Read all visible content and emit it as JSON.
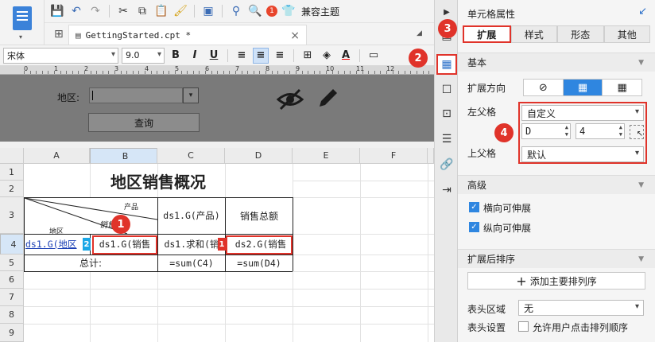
{
  "toolbar": {
    "badge_count": "1",
    "theme_label": "兼容主题"
  },
  "tabbar": {
    "file_tab": "GettingStarted.cpt *",
    "close": "×"
  },
  "format": {
    "font": "宋体",
    "size": "9.0"
  },
  "param_pane": {
    "area_label": "地区:",
    "query_button": "查询",
    "ruler_labels": [
      "0",
      "1",
      "2",
      "3",
      "4",
      "5",
      "6",
      "7",
      "8",
      "9",
      "10",
      "11",
      "12"
    ]
  },
  "sheet": {
    "columns": [
      "A",
      "B",
      "C",
      "D",
      "E",
      "F"
    ],
    "rows": [
      "1",
      "2",
      "3",
      "4",
      "5",
      "6",
      "7",
      "8",
      "9"
    ],
    "title": "地区销售概况",
    "header_product": "产品",
    "header_sales": "销售",
    "header_region": "地区",
    "c3": "ds1.G(产品)",
    "d3": "销售总额",
    "a4": "ds1.G(地区",
    "b4": "ds1.G(销售",
    "c4": "ds1.求和(销",
    "d4": "ds2.G(销售",
    "a5": "总计:",
    "c5": "=sum(C4)",
    "d5": "=sum(D4)",
    "badge_1": "1",
    "badge_2": "2",
    "mini_badge_a": "2",
    "mini_badge_d": "1"
  },
  "right_panel": {
    "title": "单元格属性",
    "badge_3": "3",
    "badge_2": "2",
    "badge_4": "4",
    "tabs": [
      "扩展",
      "样式",
      "形态",
      "其他"
    ],
    "basic_section": "基本",
    "expand_direction": "扩展方向",
    "left_parent": "左父格",
    "left_parent_value": "自定义",
    "left_col": "D",
    "left_row": "4",
    "up_parent": "上父格",
    "up_parent_value": "默认",
    "advanced_section": "高级",
    "h_expand": "横向可伸展",
    "v_expand": "纵向可伸展",
    "sort_section": "扩展后排序",
    "add_sort": "添加主要排列序",
    "header_area": "表头区域",
    "header_area_value": "无",
    "header_settings": "表头设置",
    "allow_sort": "允许用户点击排列顺序"
  }
}
